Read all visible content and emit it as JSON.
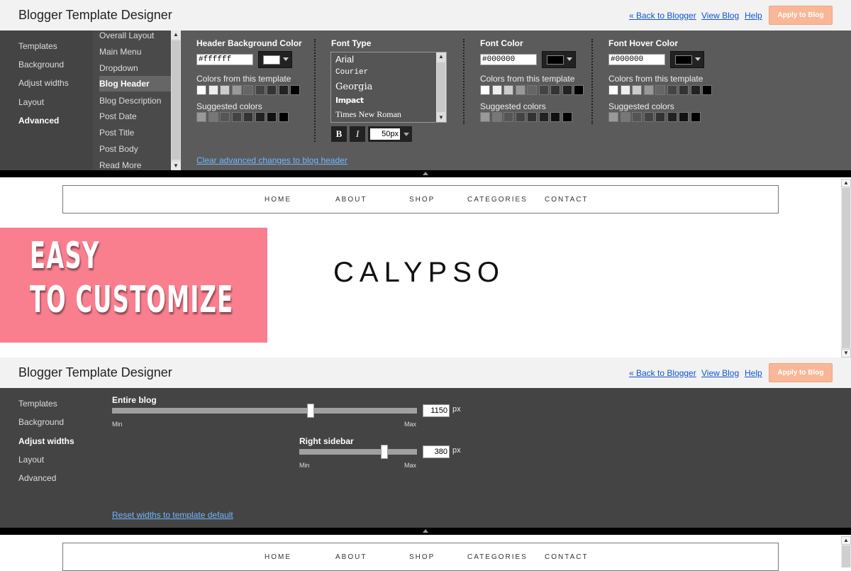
{
  "app": {
    "title": "Blogger Template Designer",
    "links": {
      "back": "« Back to Blogger",
      "view": "View Blog",
      "help": "Help"
    },
    "apply_label": "Apply to Blog"
  },
  "panel1": {
    "nav": [
      "Templates",
      "Background",
      "Adjust widths",
      "Layout",
      "Advanced"
    ],
    "nav_selected": "Advanced",
    "subnav": [
      "Overall Layout",
      "Main Menu",
      "Dropdown",
      "Blog Header",
      "Blog Description",
      "Post Date",
      "Post Title",
      "Post Body",
      "Read More"
    ],
    "subnav_selected": "Blog Header",
    "header_bg": {
      "label": "Header Background Color",
      "value": "#ffffff",
      "swatch_color": "#ffffff",
      "template_colors_label": "Colors from this template",
      "suggested_label": "Suggested colors"
    },
    "font_type": {
      "label": "Font Type",
      "fonts": [
        "Arial",
        "Courier",
        "Georgia",
        "Impact",
        "Times New Roman"
      ],
      "bold_label": "B",
      "italic_label": "I",
      "size": "50px"
    },
    "font_color": {
      "label": "Font Color",
      "value": "#000000",
      "swatch_color": "#000000",
      "template_colors_label": "Colors from this template",
      "suggested_label": "Suggested colors"
    },
    "font_hover": {
      "label": "Font Hover Color",
      "value": "#000000",
      "swatch_color": "#000000",
      "template_colors_label": "Colors from this template",
      "suggested_label": "Suggested colors"
    },
    "template_swatches": [
      "#ffffff",
      "#eeeeee",
      "#cccccc",
      "#999999",
      "#666666",
      "#444444",
      "#333333",
      "#222222",
      "#000000"
    ],
    "suggested_swatches": [
      "#999999",
      "#777777",
      "#555555",
      "#444444",
      "#333333",
      "#222222",
      "#111111",
      "#000000"
    ],
    "clear_link": "Clear advanced changes to blog header"
  },
  "preview": {
    "nav": [
      "HOME",
      "ABOUT",
      "SHOP",
      "CATEGORIES",
      "CONTACT"
    ],
    "promo_line1": "EASY",
    "promo_line2": "TO CUSTOMIZE",
    "promo_color": "#f97f8f",
    "logo": "CALYPSO"
  },
  "panel2": {
    "nav": [
      "Templates",
      "Background",
      "Adjust widths",
      "Layout",
      "Advanced"
    ],
    "nav_selected": "Adjust widths",
    "entire_blog": {
      "label": "Entire blog",
      "value": "1150",
      "unit": "px",
      "min": "Min",
      "max": "Max",
      "level": 0.65
    },
    "right_sidebar": {
      "label": "Right sidebar",
      "value": "380",
      "unit": "px",
      "min": "Min",
      "max": "Max",
      "level": 0.72
    },
    "reset_link": "Reset widths to template default"
  }
}
